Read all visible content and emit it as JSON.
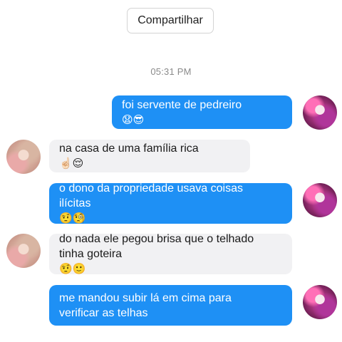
{
  "share_button": {
    "label": "Compartilhar"
  },
  "timestamp": "05:31 PM",
  "messages": [
    {
      "direction": "outgoing",
      "text": "foi servente de pedreiro",
      "emoji": "😧😎"
    },
    {
      "direction": "incoming",
      "text": "na casa de uma família rica",
      "emoji": "☝🏻😌"
    },
    {
      "direction": "outgoing",
      "line1": "o dono da propriedade usava coisas",
      "line2": "ilícitas",
      "emoji": "🤨🧐"
    },
    {
      "direction": "incoming",
      "line1": "do nada ele pegou brisa que o telhado",
      "line2": "tinha goteira",
      "emoji": "🤨🙂"
    },
    {
      "direction": "outgoing",
      "line1": "me mandou subir lá em cima para",
      "line2": "verificar as telhas"
    }
  ],
  "colors": {
    "outgoing_bubble": "#1e90f5",
    "incoming_bubble": "#f1f1f3"
  },
  "avatars": {
    "self": "pink-anime-avatar",
    "contact": "beige-anime-avatar"
  }
}
